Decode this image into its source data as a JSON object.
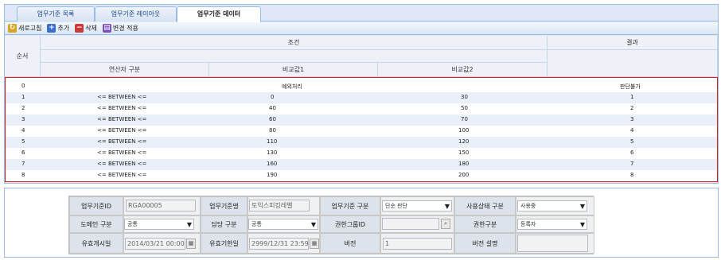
{
  "tabs": [
    "업무기준 목록",
    "업무기준 레이아웃",
    "업무기준 데이터"
  ],
  "toolbar": {
    "refresh": "새로고침",
    "add": "추가",
    "delete": "삭제",
    "apply": "변경 적용"
  },
  "grid": {
    "h_seq": "순서",
    "h_cond": "조건",
    "h_result": "결과",
    "h_op": "연산자 구분",
    "h_cmp1": "비교값1",
    "h_cmp2": "비교값2",
    "rows": [
      {
        "seq": "0",
        "op": "",
        "v1": "예외처리",
        "v2": "",
        "res": "판단불가"
      },
      {
        "seq": "1",
        "op": "<= BETWEEN <=",
        "v1": "0",
        "v2": "30",
        "res": "1"
      },
      {
        "seq": "2",
        "op": "<= BETWEEN <=",
        "v1": "40",
        "v2": "50",
        "res": "2"
      },
      {
        "seq": "3",
        "op": "<= BETWEEN <=",
        "v1": "60",
        "v2": "70",
        "res": "3"
      },
      {
        "seq": "4",
        "op": "<= BETWEEN <=",
        "v1": "80",
        "v2": "100",
        "res": "4"
      },
      {
        "seq": "5",
        "op": "<= BETWEEN <=",
        "v1": "110",
        "v2": "120",
        "res": "5"
      },
      {
        "seq": "6",
        "op": "<= BETWEEN <=",
        "v1": "130",
        "v2": "150",
        "res": "6"
      },
      {
        "seq": "7",
        "op": "<= BETWEEN <=",
        "v1": "160",
        "v2": "180",
        "res": "7"
      },
      {
        "seq": "8",
        "op": "<= BETWEEN <=",
        "v1": "190",
        "v2": "200",
        "res": "8"
      }
    ]
  },
  "form": {
    "l_id": "업무기준ID",
    "v_id": "RGA00005",
    "l_name": "업무기준명",
    "v_name": "토익스피킹레벨",
    "l_type": "업무기준 구분",
    "v_type": "단순 판단",
    "l_status": "사용상태 구분",
    "v_status": "사용중",
    "l_domain": "도메인 구분",
    "v_domain": "공통",
    "l_owner": "담당 구분",
    "v_owner": "공통",
    "l_group": "권한그룹ID",
    "v_group": "",
    "l_auth": "권한구분",
    "v_auth": "등록자",
    "l_start": "유효개시일",
    "v_start": "2014/03/21 00:00",
    "l_end": "유효기한일",
    "v_end": "2999/12/31 23:59",
    "l_ver": "버전",
    "v_ver": "1",
    "l_verdesc": "버전 설명",
    "v_verdesc": ""
  }
}
